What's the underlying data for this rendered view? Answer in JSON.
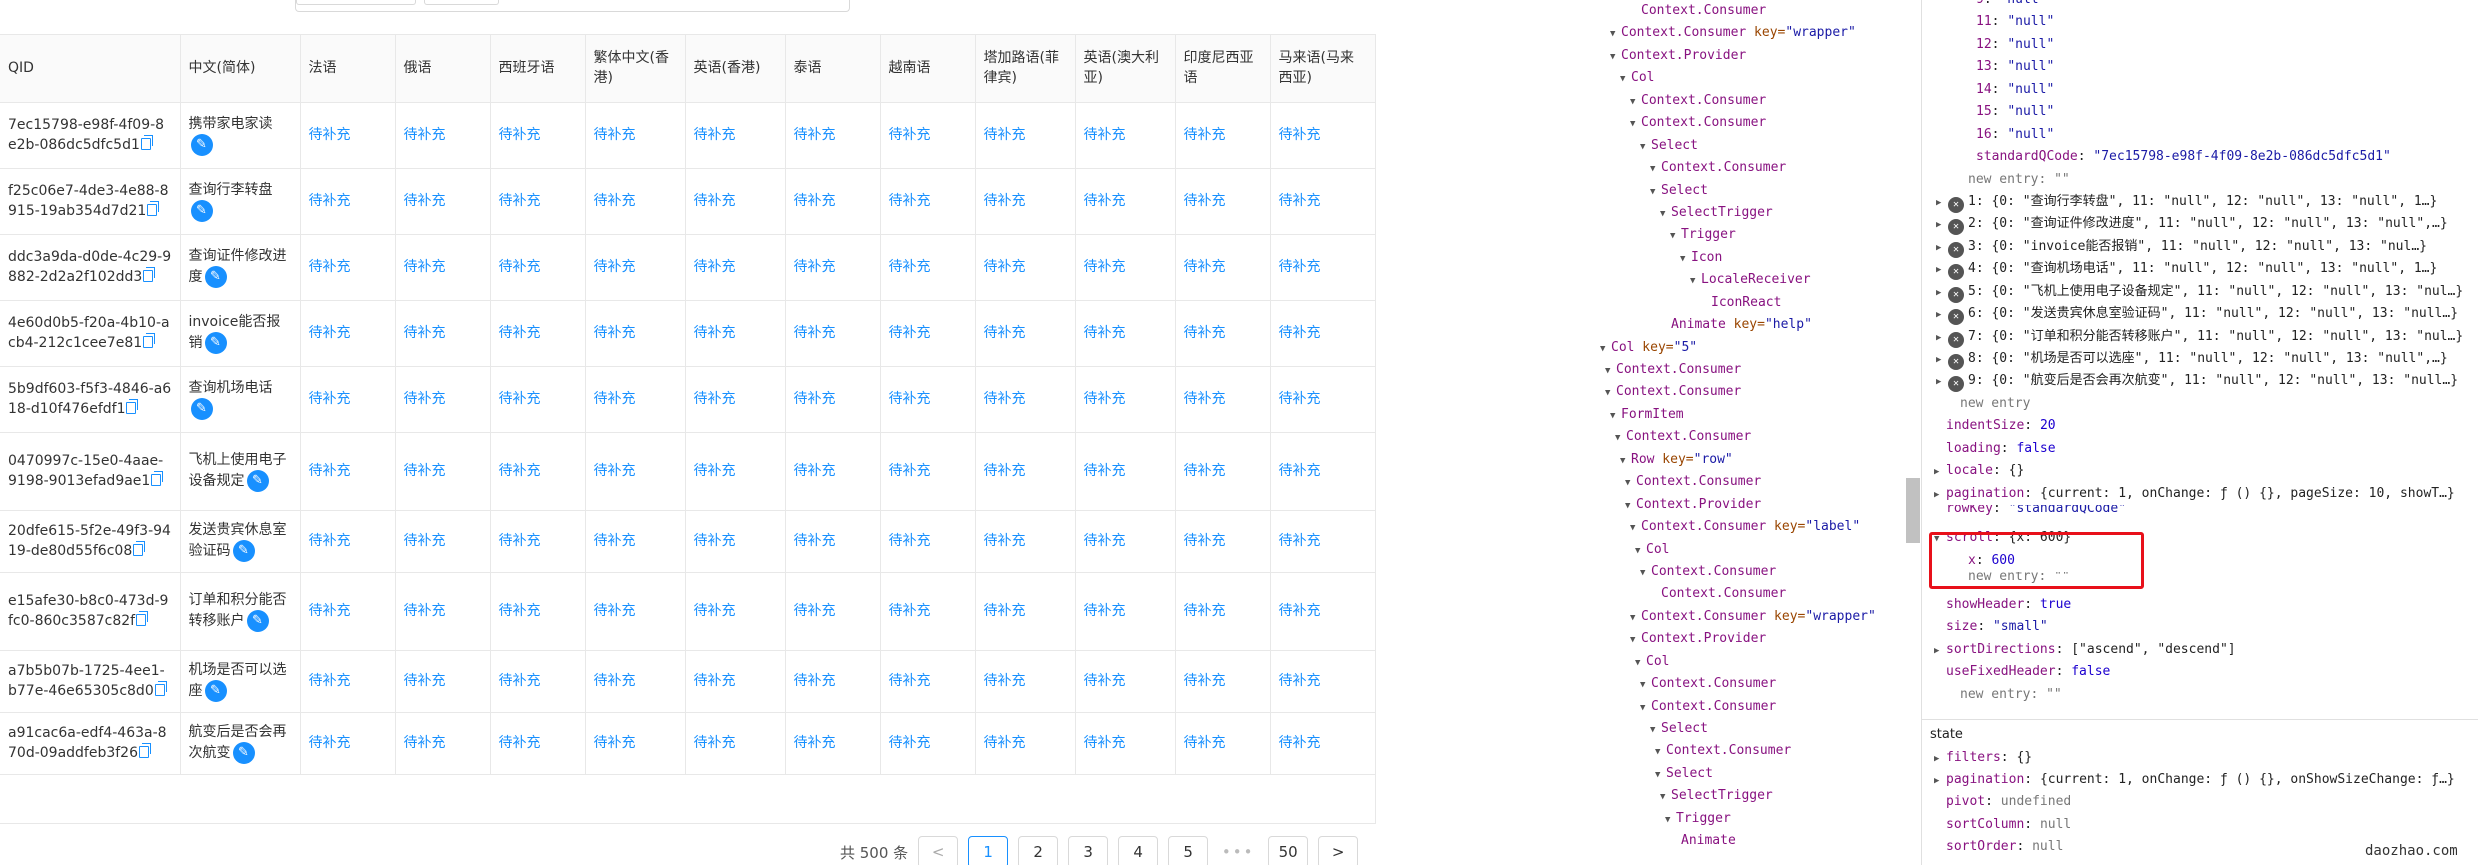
{
  "table": {
    "headers": [
      "QID",
      "中文(简体)",
      "法语",
      "俄语",
      "西班牙语",
      "繁体中文(香港)",
      "英语(香港)",
      "泰语",
      "越南语",
      "塔加路语(菲律宾)",
      "英语(澳大利亚)",
      "印度尼西亚语",
      "马来语(马来西亚)"
    ],
    "fill_text": "待补充",
    "rows": [
      {
        "qid": "7ec15798-e98f-4f09-8e2b-086dc5dfc5d1",
        "cn": "携带家电家读"
      },
      {
        "qid": "f25c06e7-4de3-4e88-8915-19ab354d7d21",
        "cn": "查询行李转盘"
      },
      {
        "qid": "ddc3a9da-d0de-4c29-9882-2d2a2f102dd3",
        "cn": "查询证件修改进度"
      },
      {
        "qid": "4e60d0b5-f20a-4b10-acb4-212c1cee7e81",
        "cn": "invoice能否报销"
      },
      {
        "qid": "5b9df603-f5f3-4846-a618-d10f476efdf1",
        "cn": "查询机场电话"
      },
      {
        "qid": "0470997c-15e0-4aae-9198-9013efad9ae1",
        "cn": "飞机上使用电子设备规定"
      },
      {
        "qid": "20dfe615-5f2e-49f3-9419-de80d55f6c08",
        "cn": "发送贵宾休息室验证码"
      },
      {
        "qid": "e15afe30-b8c0-473d-9fc0-860c3587c82f",
        "cn": "订单和积分能否转移账户"
      },
      {
        "qid": "a7b5b07b-1725-4ee1-b77e-46e65305c8d0",
        "cn": "机场是否可以选座"
      },
      {
        "qid": "a91cac6a-edf4-463a-870d-09addfeb3f26",
        "cn": "航变后是否会再次航变"
      }
    ]
  },
  "pagination": {
    "total": "共 500 条",
    "prev": "<",
    "pages": [
      "1",
      "2",
      "3",
      "4",
      "5"
    ],
    "dots": "•••",
    "last": "50",
    "next": ">"
  },
  "tree": [
    {
      "i": 3,
      "t": "",
      "tag": "Context.Consumer"
    },
    {
      "i": 1,
      "t": "▼",
      "tag": "Context.Consumer",
      "key": "\"wrapper\""
    },
    {
      "i": 1,
      "t": "▼",
      "tag": "Context.Provider"
    },
    {
      "i": 2,
      "t": "▼",
      "tag": "Col"
    },
    {
      "i": 3,
      "t": "▼",
      "tag": "Context.Consumer"
    },
    {
      "i": 3,
      "t": "▼",
      "tag": "Context.Consumer"
    },
    {
      "i": 4,
      "t": "▼",
      "tag": "Select"
    },
    {
      "i": 5,
      "t": "▼",
      "tag": "Context.Consumer"
    },
    {
      "i": 5,
      "t": "▼",
      "tag": "Select"
    },
    {
      "i": 6,
      "t": "▼",
      "tag": "SelectTrigger"
    },
    {
      "i": 7,
      "t": "▼",
      "tag": "Trigger"
    },
    {
      "i": 8,
      "t": "▼",
      "tag": "Icon"
    },
    {
      "i": 9,
      "t": "▼",
      "tag": "LocaleReceiver"
    },
    {
      "i": 10,
      "t": "",
      "tag": "IconReact"
    },
    {
      "i": 6,
      "t": "",
      "tag": "Animate",
      "key": "\"help\""
    },
    {
      "i": 0,
      "t": "▼",
      "tag": "Col",
      "key": "\"5\""
    },
    {
      "i": 0.5,
      "t": "▼",
      "tag": "Context.Consumer"
    },
    {
      "i": 0.5,
      "t": "▼",
      "tag": "Context.Consumer"
    },
    {
      "i": 1,
      "t": "▼",
      "tag": "FormItem"
    },
    {
      "i": 1.5,
      "t": "▼",
      "tag": "Context.Consumer"
    },
    {
      "i": 2,
      "t": "▼",
      "tag": "Row",
      "key": "\"row\""
    },
    {
      "i": 2.5,
      "t": "▼",
      "tag": "Context.Consumer"
    },
    {
      "i": 2.5,
      "t": "▼",
      "tag": "Context.Provider"
    },
    {
      "i": 3,
      "t": "▼",
      "tag": "Context.Consumer",
      "key": "\"label\""
    },
    {
      "i": 3.5,
      "t": "▼",
      "tag": "Col"
    },
    {
      "i": 4,
      "t": "▼",
      "tag": "Context.Consumer"
    },
    {
      "i": 5,
      "t": "",
      "tag": "Context.Consumer"
    },
    {
      "i": 3,
      "t": "▼",
      "tag": "Context.Consumer",
      "key": "\"wrapper\""
    },
    {
      "i": 3,
      "t": "▼",
      "tag": "Context.Provider"
    },
    {
      "i": 3.5,
      "t": "▼",
      "tag": "Col"
    },
    {
      "i": 4,
      "t": "▼",
      "tag": "Context.Consumer"
    },
    {
      "i": 4,
      "t": "▼",
      "tag": "Context.Consumer"
    },
    {
      "i": 5,
      "t": "▼",
      "tag": "Select"
    },
    {
      "i": 5.5,
      "t": "▼",
      "tag": "Context.Consumer"
    },
    {
      "i": 5.5,
      "t": "▼",
      "tag": "Select"
    },
    {
      "i": 6,
      "t": "▼",
      "tag": "SelectTrigger"
    },
    {
      "i": 6.5,
      "t": "▼",
      "tag": "Trigger"
    },
    {
      "i": 7,
      "t": "",
      "tag": "Animate"
    }
  ],
  "props": {
    "top_entries": [
      {
        "k": "9",
        "v": "\"null\""
      },
      {
        "k": "11",
        "v": "\"null\""
      },
      {
        "k": "12",
        "v": "\"null\""
      },
      {
        "k": "13",
        "v": "\"null\""
      },
      {
        "k": "14",
        "v": "\"null\""
      },
      {
        "k": "15",
        "v": "\"null\""
      },
      {
        "k": "16",
        "v": "\"null\""
      },
      {
        "k": "standardQCode",
        "v": "\"7ec15798-e98f-4f09-8e2b-086dc5dfc5d1\""
      }
    ],
    "new_entry": "new entry: \"\"",
    "data_rows": [
      "1: {0: \"查询行李转盘\", 11: \"null\", 12: \"null\", 13: \"null\", 1…}",
      "2: {0: \"查询证件修改进度\", 11: \"null\", 12: \"null\", 13: \"null\",…}",
      "3: {0: \"invoice能否报销\", 11: \"null\", 12: \"null\", 13: \"nul…}",
      "4: {0: \"查询机场电话\", 11: \"null\", 12: \"null\", 13: \"null\", 1…}",
      "5: {0: \"飞机上使用电子设备规定\", 11: \"null\", 12: \"null\", 13: \"nul…}",
      "6: {0: \"发送贵宾休息室验证码\", 11: \"null\", 12: \"null\", 13: \"null…}",
      "7: {0: \"订单和积分能否转移账户\", 11: \"null\", 12: \"null\", 13: \"nul…}",
      "8: {0: \"机场是否可以选座\", 11: \"null\", 12: \"null\", 13: \"null\",…}",
      "9: {0: \"航变后是否会再次航变\", 11: \"null\", 12: \"null\", 13: \"null…}"
    ],
    "new_entry_plain": "new entry",
    "indentSize": "20",
    "loading": "false",
    "locale": "{}",
    "pagination": "{current: 1, onChange: ƒ () {}, pageSize: 10, showT…}",
    "rowKey": "\"standardQCode\"",
    "scroll": "{x: 600}",
    "scroll_x": "600",
    "new_entry_scroll": "new entry: \"\"",
    "showHeader": "true",
    "size": "\"small\"",
    "sortDirections": "[\"ascend\", \"descend\"]",
    "useFixedHeader": "false",
    "new_entry_end": "new entry: \"\"",
    "state_title": "state",
    "filters": "{}",
    "state_pagination": "{current: 1, onChange: ƒ () {}, onShowSizeChange: ƒ…}",
    "pivot": "undefined",
    "sortColumn": "null",
    "sortOrder": "null"
  },
  "watermark": "daozhao.com"
}
